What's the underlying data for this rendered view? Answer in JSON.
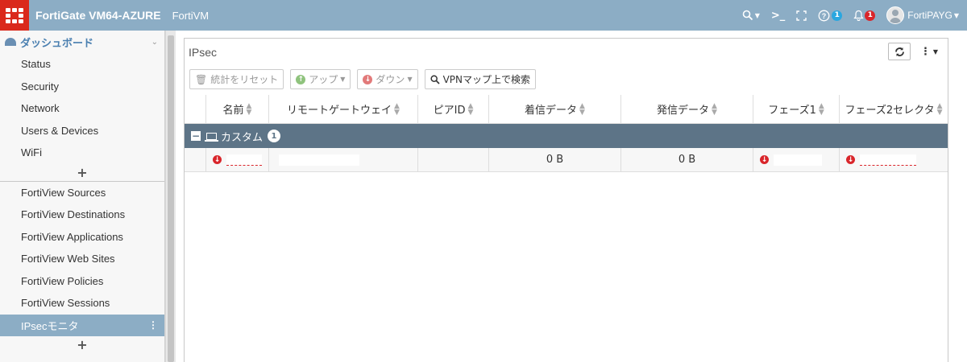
{
  "topbar": {
    "brand": "FortiGate VM64-AZURE",
    "hostname": "FortiVM",
    "help_badge": "1",
    "alert_badge": "1",
    "user": "FortiPAYG"
  },
  "sidebar": {
    "dashboard_title": "ダッシュボード",
    "dashboard_items": [
      "Status",
      "Security",
      "Network",
      "Users & Devices",
      "WiFi"
    ],
    "fortiview_items": [
      "FortiView Sources",
      "FortiView Destinations",
      "FortiView Applications",
      "FortiView Web Sites",
      "FortiView Policies",
      "FortiView Sessions"
    ],
    "active_item": "IPsecモニタ"
  },
  "panel": {
    "title": "IPsec",
    "toolbar": {
      "reset_stats": "統計をリセット",
      "up": "アップ",
      "down": "ダウン",
      "vpn_map_search": "VPNマップ上で検索"
    },
    "columns": [
      "名前",
      "リモートゲートウェイ",
      "ピアID",
      "着信データ",
      "発信データ",
      "フェーズ1",
      "フェーズ2セレクタ"
    ],
    "group": {
      "label": "カスタム",
      "count": "1"
    },
    "rows": [
      {
        "incoming": "0 B",
        "outgoing": "0 B"
      }
    ]
  },
  "colors": {
    "topbar": "#8cadc5",
    "logo": "#da291c",
    "group_row": "#5d7487",
    "status_down": "#d9262b"
  }
}
